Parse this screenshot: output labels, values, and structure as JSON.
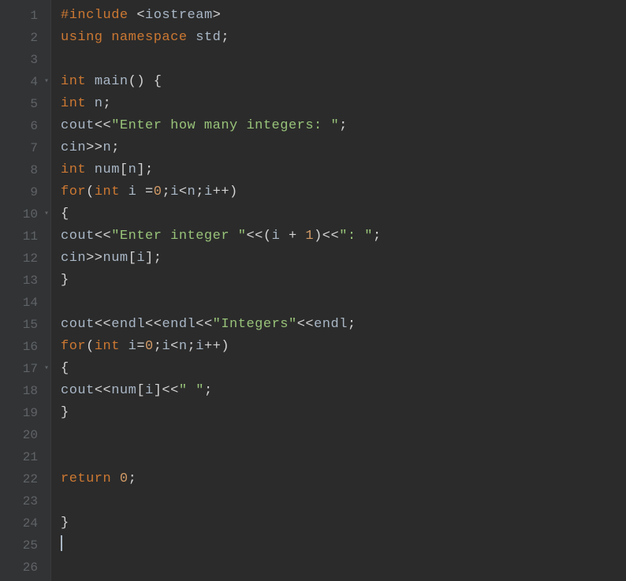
{
  "editor": {
    "lines": [
      {
        "num": "1",
        "fold": false,
        "tokens": [
          {
            "c": "tok-preproc",
            "t": "#include "
          },
          {
            "c": "tok-angle",
            "t": "<"
          },
          {
            "c": "tok-default",
            "t": "iostream"
          },
          {
            "c": "tok-angle",
            "t": ">"
          }
        ]
      },
      {
        "num": "2",
        "fold": false,
        "tokens": [
          {
            "c": "tok-keyword",
            "t": "using"
          },
          {
            "c": "tok-default",
            "t": " "
          },
          {
            "c": "tok-keyword",
            "t": "namespace"
          },
          {
            "c": "tok-default",
            "t": " std"
          },
          {
            "c": "tok-punct",
            "t": ";"
          }
        ]
      },
      {
        "num": "3",
        "fold": false,
        "tokens": []
      },
      {
        "num": "4",
        "fold": true,
        "tokens": [
          {
            "c": "tok-type",
            "t": "int"
          },
          {
            "c": "tok-default",
            "t": " "
          },
          {
            "c": "tok-func",
            "t": "main"
          },
          {
            "c": "tok-punct",
            "t": "()"
          },
          {
            "c": "tok-default",
            "t": " "
          },
          {
            "c": "tok-punct",
            "t": "{"
          }
        ]
      },
      {
        "num": "5",
        "fold": false,
        "tokens": [
          {
            "c": "tok-type",
            "t": "int"
          },
          {
            "c": "tok-default",
            "t": " n"
          },
          {
            "c": "tok-punct",
            "t": ";"
          }
        ]
      },
      {
        "num": "6",
        "fold": false,
        "tokens": [
          {
            "c": "tok-default",
            "t": "cout"
          },
          {
            "c": "tok-punct",
            "t": "<<"
          },
          {
            "c": "tok-string",
            "t": "\"Enter how many integers: \""
          },
          {
            "c": "tok-punct",
            "t": ";"
          }
        ]
      },
      {
        "num": "7",
        "fold": false,
        "tokens": [
          {
            "c": "tok-default",
            "t": "cin"
          },
          {
            "c": "tok-punct",
            "t": ">>"
          },
          {
            "c": "tok-default",
            "t": "n"
          },
          {
            "c": "tok-punct",
            "t": ";"
          }
        ]
      },
      {
        "num": "8",
        "fold": false,
        "tokens": [
          {
            "c": "tok-type",
            "t": "int"
          },
          {
            "c": "tok-default",
            "t": " num"
          },
          {
            "c": "tok-punct",
            "t": "["
          },
          {
            "c": "tok-default",
            "t": "n"
          },
          {
            "c": "tok-punct",
            "t": "];"
          }
        ]
      },
      {
        "num": "9",
        "fold": false,
        "tokens": [
          {
            "c": "tok-keyword",
            "t": "for"
          },
          {
            "c": "tok-punct",
            "t": "("
          },
          {
            "c": "tok-type",
            "t": "int"
          },
          {
            "c": "tok-default",
            "t": " i "
          },
          {
            "c": "tok-punct",
            "t": "="
          },
          {
            "c": "tok-number",
            "t": "0"
          },
          {
            "c": "tok-punct",
            "t": ";"
          },
          {
            "c": "tok-default",
            "t": "i"
          },
          {
            "c": "tok-punct",
            "t": "<"
          },
          {
            "c": "tok-default",
            "t": "n"
          },
          {
            "c": "tok-punct",
            "t": ";"
          },
          {
            "c": "tok-default",
            "t": "i"
          },
          {
            "c": "tok-punct",
            "t": "++)"
          }
        ]
      },
      {
        "num": "10",
        "fold": true,
        "tokens": [
          {
            "c": "tok-punct",
            "t": "{"
          }
        ]
      },
      {
        "num": "11",
        "fold": false,
        "tokens": [
          {
            "c": "tok-default",
            "t": "cout"
          },
          {
            "c": "tok-punct",
            "t": "<<"
          },
          {
            "c": "tok-string",
            "t": "\"Enter integer \""
          },
          {
            "c": "tok-punct",
            "t": "<<("
          },
          {
            "c": "tok-default",
            "t": "i "
          },
          {
            "c": "tok-punct",
            "t": "+"
          },
          {
            "c": "tok-default",
            "t": " "
          },
          {
            "c": "tok-number",
            "t": "1"
          },
          {
            "c": "tok-punct",
            "t": ")<<"
          },
          {
            "c": "tok-string",
            "t": "\": \""
          },
          {
            "c": "tok-punct",
            "t": ";"
          }
        ]
      },
      {
        "num": "12",
        "fold": false,
        "tokens": [
          {
            "c": "tok-default",
            "t": "cin"
          },
          {
            "c": "tok-punct",
            "t": ">>"
          },
          {
            "c": "tok-default",
            "t": "num"
          },
          {
            "c": "tok-punct",
            "t": "["
          },
          {
            "c": "tok-default",
            "t": "i"
          },
          {
            "c": "tok-punct",
            "t": "];"
          }
        ]
      },
      {
        "num": "13",
        "fold": false,
        "tokens": [
          {
            "c": "tok-punct",
            "t": "}"
          }
        ]
      },
      {
        "num": "14",
        "fold": false,
        "tokens": []
      },
      {
        "num": "15",
        "fold": false,
        "tokens": [
          {
            "c": "tok-default",
            "t": "cout"
          },
          {
            "c": "tok-punct",
            "t": "<<"
          },
          {
            "c": "tok-default",
            "t": "endl"
          },
          {
            "c": "tok-punct",
            "t": "<<"
          },
          {
            "c": "tok-default",
            "t": "endl"
          },
          {
            "c": "tok-punct",
            "t": "<<"
          },
          {
            "c": "tok-string",
            "t": "\"Integers\""
          },
          {
            "c": "tok-punct",
            "t": "<<"
          },
          {
            "c": "tok-default",
            "t": "endl"
          },
          {
            "c": "tok-punct",
            "t": ";"
          }
        ]
      },
      {
        "num": "16",
        "fold": false,
        "tokens": [
          {
            "c": "tok-keyword",
            "t": "for"
          },
          {
            "c": "tok-punct",
            "t": "("
          },
          {
            "c": "tok-type",
            "t": "int"
          },
          {
            "c": "tok-default",
            "t": " i"
          },
          {
            "c": "tok-punct",
            "t": "="
          },
          {
            "c": "tok-number",
            "t": "0"
          },
          {
            "c": "tok-punct",
            "t": ";"
          },
          {
            "c": "tok-default",
            "t": "i"
          },
          {
            "c": "tok-punct",
            "t": "<"
          },
          {
            "c": "tok-default",
            "t": "n"
          },
          {
            "c": "tok-punct",
            "t": ";"
          },
          {
            "c": "tok-default",
            "t": "i"
          },
          {
            "c": "tok-punct",
            "t": "++)"
          }
        ]
      },
      {
        "num": "17",
        "fold": true,
        "tokens": [
          {
            "c": "tok-punct",
            "t": "{"
          }
        ]
      },
      {
        "num": "18",
        "fold": false,
        "tokens": [
          {
            "c": "tok-default",
            "t": "cout"
          },
          {
            "c": "tok-punct",
            "t": "<<"
          },
          {
            "c": "tok-default",
            "t": "num"
          },
          {
            "c": "tok-punct",
            "t": "["
          },
          {
            "c": "tok-default",
            "t": "i"
          },
          {
            "c": "tok-punct",
            "t": "]<<"
          },
          {
            "c": "tok-string",
            "t": "\" \""
          },
          {
            "c": "tok-punct",
            "t": ";"
          }
        ]
      },
      {
        "num": "19",
        "fold": false,
        "tokens": [
          {
            "c": "tok-punct",
            "t": "}"
          }
        ]
      },
      {
        "num": "20",
        "fold": false,
        "tokens": []
      },
      {
        "num": "21",
        "fold": false,
        "tokens": []
      },
      {
        "num": "22",
        "fold": false,
        "tokens": [
          {
            "c": "tok-keyword",
            "t": "return"
          },
          {
            "c": "tok-default",
            "t": " "
          },
          {
            "c": "tok-number",
            "t": "0"
          },
          {
            "c": "tok-punct",
            "t": ";"
          }
        ]
      },
      {
        "num": "23",
        "fold": false,
        "tokens": []
      },
      {
        "num": "24",
        "fold": false,
        "tokens": [
          {
            "c": "tok-punct",
            "t": "}"
          }
        ]
      },
      {
        "num": "25",
        "fold": false,
        "tokens": [],
        "cursor": true
      },
      {
        "num": "26",
        "fold": false,
        "tokens": []
      }
    ]
  }
}
